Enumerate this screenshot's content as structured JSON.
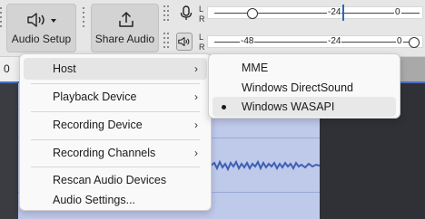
{
  "toolbar": {
    "audio_setup_label": "Audio Setup",
    "share_audio_label": "Share Audio",
    "record_meter": {
      "channels": [
        "L",
        "R"
      ],
      "ticks": [
        "-24",
        "0"
      ]
    },
    "playback_meter": {
      "channels": [
        "L",
        "R"
      ],
      "ticks": [
        "-48",
        "-24",
        "0"
      ]
    }
  },
  "timeline": {
    "ruler_start": "0"
  },
  "audio_setup_menu": {
    "items": [
      {
        "label": "Host",
        "submenu": true
      },
      {
        "label": "Playback Device",
        "submenu": true
      },
      {
        "label": "Recording Device",
        "submenu": true
      },
      {
        "label": "Recording Channels",
        "submenu": true
      },
      {
        "label": "Rescan Audio Devices",
        "submenu": false
      },
      {
        "label": "Audio Settings...",
        "submenu": false
      }
    ],
    "arrow_glyph": "›"
  },
  "host_submenu": {
    "items": [
      {
        "label": "MME",
        "selected": false
      },
      {
        "label": "Windows DirectSound",
        "selected": false
      },
      {
        "label": "Windows WASAPI",
        "selected": true
      }
    ]
  },
  "colors": {
    "toolbar_bg": "#e6e6e6",
    "button_bg": "#d3d3d3",
    "menu_bg": "#f9f9f9",
    "track_wave_bg": "#bfc9ea",
    "waveform": "#3f5fb5",
    "selection_dark": "#2f3137"
  },
  "icons": {
    "audio_setup": "speaker-dropdown-icon",
    "share_audio": "share-upload-icon",
    "record_meter": "microphone-icon",
    "playback_meter": "speaker-icon"
  }
}
